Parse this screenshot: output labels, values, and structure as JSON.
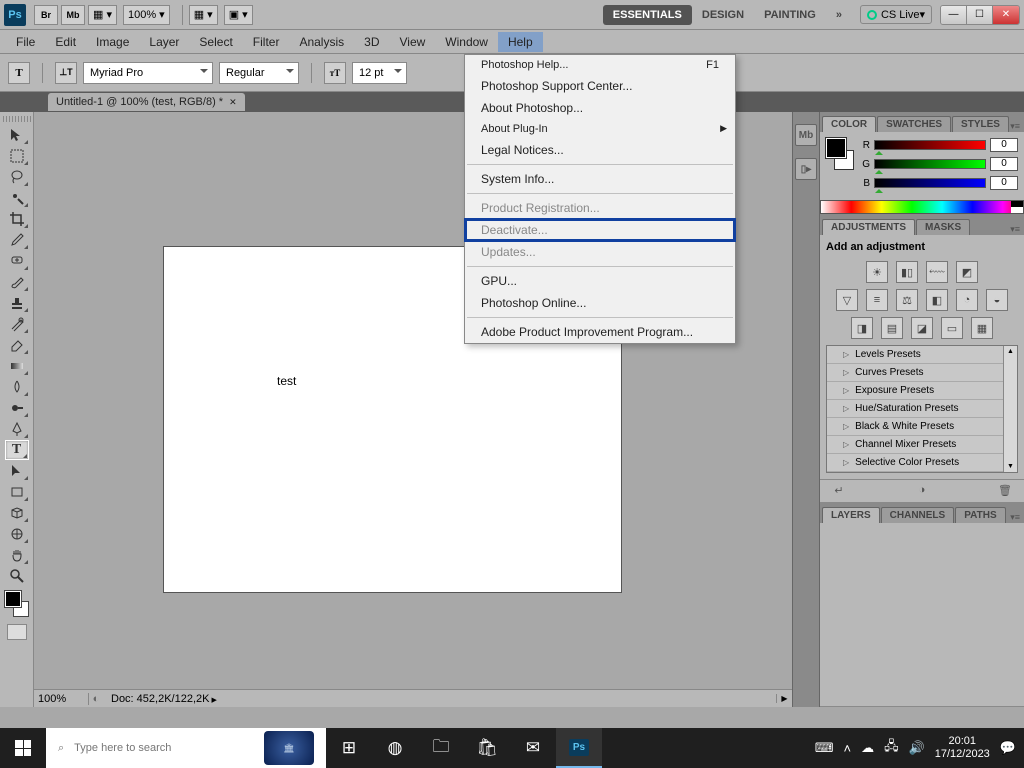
{
  "titlebar": {
    "zoom_pct": "100%",
    "workspaces": [
      "ESSENTIALS",
      "DESIGN",
      "PAINTING"
    ],
    "cslive": "CS Live"
  },
  "menubar": [
    "File",
    "Edit",
    "Image",
    "Layer",
    "Select",
    "Filter",
    "Analysis",
    "3D",
    "View",
    "Window",
    "Help"
  ],
  "options": {
    "font_family": "Myriad Pro",
    "font_style": "Regular",
    "font_size": "12 pt"
  },
  "doc_tab": "Untitled-1 @ 100% (test, RGB/8) *",
  "canvas_text": "test",
  "status": {
    "zoom": "100%",
    "doc": "Doc: 452,2K/122,2K"
  },
  "help_menu": {
    "items": [
      {
        "label": "Photoshop Help...",
        "shortcut": "F1"
      },
      {
        "label": "Photoshop Support Center..."
      },
      {
        "label": "About Photoshop..."
      },
      {
        "label": "About Plug-In",
        "submenu": true
      },
      {
        "label": "Legal Notices..."
      },
      {
        "sep": true
      },
      {
        "label": "System Info..."
      },
      {
        "sep": true
      },
      {
        "label": "Product Registration...",
        "dim": true
      },
      {
        "label": "Deactivate...",
        "highlighted": true,
        "dim": true
      },
      {
        "label": "Updates...",
        "dim": true
      },
      {
        "sep": true
      },
      {
        "label": "GPU..."
      },
      {
        "label": "Photoshop Online..."
      },
      {
        "sep": true
      },
      {
        "label": "Adobe Product Improvement Program..."
      }
    ]
  },
  "color_panel": {
    "tabs": [
      "COLOR",
      "SWATCHES",
      "STYLES"
    ],
    "r_label": "R",
    "g_label": "G",
    "b_label": "B",
    "r_val": "0",
    "g_val": "0",
    "b_val": "0"
  },
  "adjustments_panel": {
    "tabs": [
      "ADJUSTMENTS",
      "MASKS"
    ],
    "title": "Add an adjustment",
    "presets": [
      "Levels Presets",
      "Curves Presets",
      "Exposure Presets",
      "Hue/Saturation Presets",
      "Black & White Presets",
      "Channel Mixer Presets",
      "Selective Color Presets"
    ]
  },
  "layers_panel": {
    "tabs": [
      "LAYERS",
      "CHANNELS",
      "PATHS"
    ]
  },
  "taskbar": {
    "search_placeholder": "Type here to search",
    "time": "20:01",
    "date": "17/12/2023"
  }
}
